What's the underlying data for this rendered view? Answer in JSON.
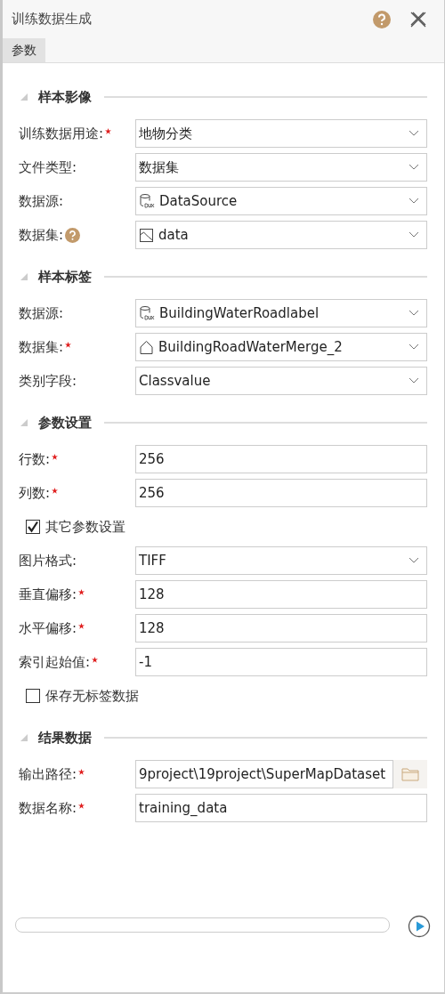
{
  "window": {
    "title": "训练数据生成"
  },
  "tabs": [
    {
      "label": "参数",
      "selected": true
    }
  ],
  "sections": [
    {
      "title": "样本影像",
      "expanded": true,
      "rows": [
        {
          "kind": "select",
          "label": "训练数据用途:",
          "required": true,
          "help": false,
          "value": "地物分类"
        },
        {
          "kind": "select",
          "label": "文件类型:",
          "required": false,
          "help": false,
          "value": "数据集"
        },
        {
          "kind": "source-select",
          "label": "数据源:",
          "required": false,
          "help": false,
          "value": "DataSource"
        },
        {
          "kind": "raster-select",
          "label": "数据集:",
          "required": false,
          "help": true,
          "value": "data"
        }
      ]
    },
    {
      "title": "样本标签",
      "expanded": true,
      "rows": [
        {
          "kind": "source-select",
          "label": "数据源:",
          "required": false,
          "help": false,
          "value": "BuildingWaterRoadlabel"
        },
        {
          "kind": "region-select",
          "label": "数据集:",
          "required": true,
          "help": false,
          "value": "BuildingRoadWaterMerge_2"
        },
        {
          "kind": "select",
          "label": "类别字段:",
          "required": false,
          "help": false,
          "value": "Classvalue"
        }
      ]
    },
    {
      "title": "参数设置",
      "expanded": true,
      "rows": [
        {
          "kind": "text",
          "label": "行数:",
          "required": true,
          "help": false,
          "value": "256"
        },
        {
          "kind": "text",
          "label": "列数:",
          "required": true,
          "help": false,
          "value": "256"
        },
        {
          "kind": "check",
          "label": "其它参数设置",
          "checked": true
        },
        {
          "kind": "select",
          "label": "图片格式:",
          "required": false,
          "help": false,
          "value": "TIFF"
        },
        {
          "kind": "text",
          "label": "垂直偏移:",
          "required": true,
          "help": false,
          "value": "128"
        },
        {
          "kind": "text",
          "label": "水平偏移:",
          "required": true,
          "help": false,
          "value": "128"
        },
        {
          "kind": "text",
          "label": "索引起始值:",
          "required": true,
          "help": false,
          "value": "-1"
        },
        {
          "kind": "check",
          "label": "保存无标签数据",
          "checked": false
        }
      ]
    },
    {
      "title": "结果数据",
      "expanded": true,
      "rows": [
        {
          "kind": "path",
          "label": "输出路径:",
          "required": true,
          "help": false,
          "value": "9project\\19project\\SuperMapDataset"
        },
        {
          "kind": "text",
          "label": "数据名称:",
          "required": true,
          "help": false,
          "value": "training_data"
        }
      ]
    }
  ],
  "progress": {
    "level": 0
  }
}
